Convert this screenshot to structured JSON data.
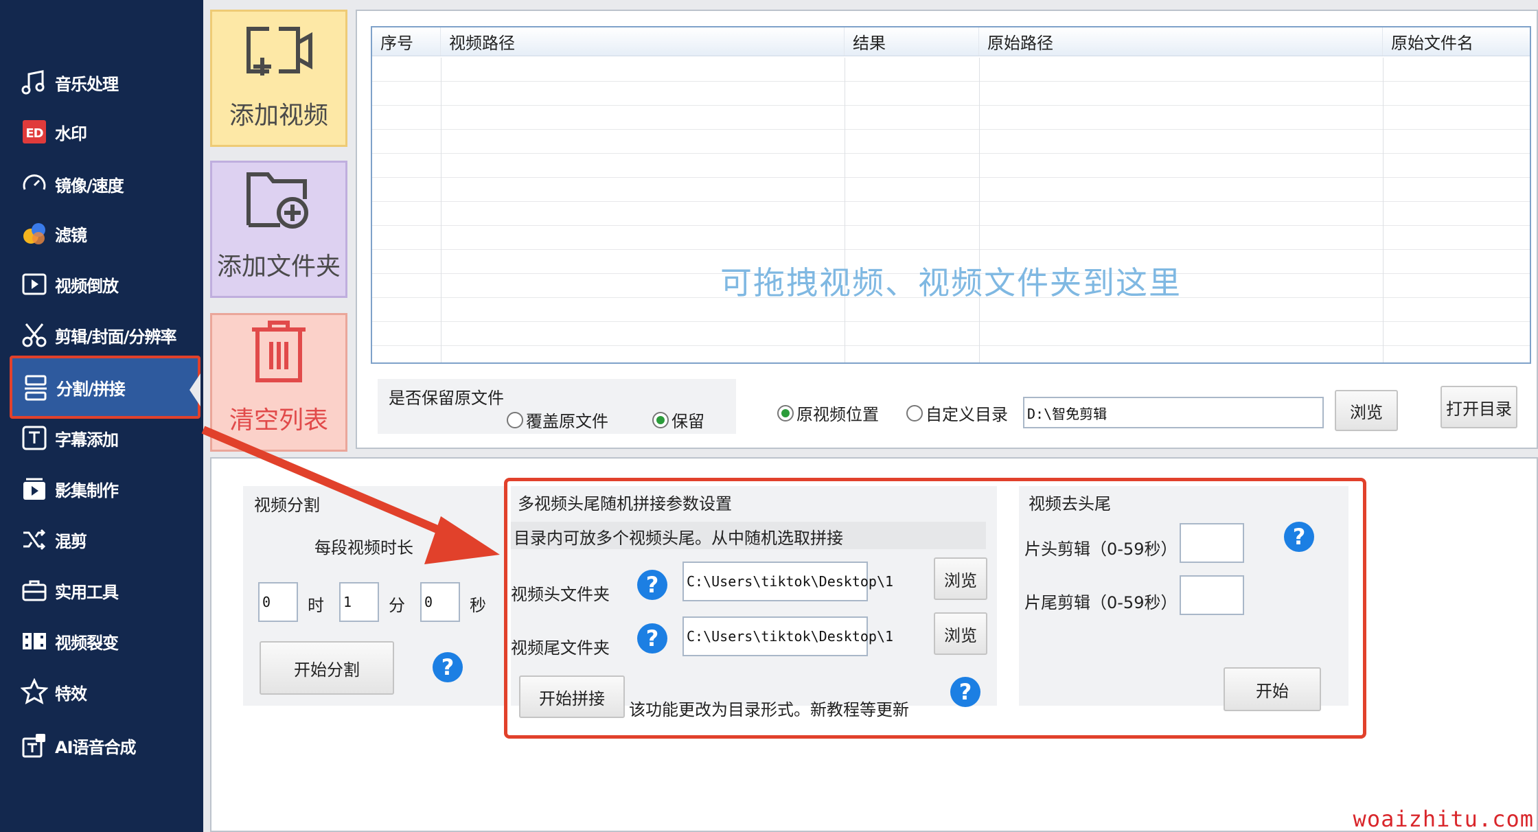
{
  "sidebar": {
    "items": [
      {
        "label": "音乐处理",
        "icon": "music-note-icon"
      },
      {
        "label": "水印",
        "icon": "watermark-icon"
      },
      {
        "label": "镜像/速度",
        "icon": "speedometer-icon"
      },
      {
        "label": "滤镜",
        "icon": "filter-circles-icon"
      },
      {
        "label": "视频倒放",
        "icon": "video-reverse-icon"
      },
      {
        "label": "剪辑/封面/分辨率",
        "icon": "scissors-icon"
      },
      {
        "label": "分割/拼接",
        "icon": "split-join-icon",
        "active": true
      },
      {
        "label": "字幕添加",
        "icon": "subtitle-icon"
      },
      {
        "label": "影集制作",
        "icon": "album-icon"
      },
      {
        "label": "混剪",
        "icon": "shuffle-icon"
      },
      {
        "label": "实用工具",
        "icon": "toolbox-icon"
      },
      {
        "label": "视频裂变",
        "icon": "film-split-icon"
      },
      {
        "label": "特效",
        "icon": "sparkle-star-icon"
      },
      {
        "label": "AI语音合成",
        "icon": "ai-voice-icon"
      }
    ]
  },
  "actions": {
    "add_video": "添加视频",
    "add_folder": "添加文件夹",
    "clear_list": "清空列表"
  },
  "table": {
    "columns": [
      "序号",
      "视频路径",
      "结果",
      "原始路径",
      "原始文件名"
    ],
    "drop_hint": "可拖拽视频、视频文件夹到这里"
  },
  "keep_original": {
    "title": "是否保留原文件",
    "overwrite": "覆盖原文件",
    "keep": "保留",
    "selected": "保留"
  },
  "output": {
    "original_location": "原视频位置",
    "custom_dir": "自定义目录",
    "selected": "原视频位置",
    "path": "D:\\智免剪辑",
    "browse": "浏览",
    "open_dir": "打开目录"
  },
  "split": {
    "title": "视频分割",
    "segment_label": "每段视频时长",
    "hours": "0",
    "hour_unit": "时",
    "minutes": "1",
    "minute_unit": "分",
    "seconds": "0",
    "second_unit": "秒",
    "start": "开始分割"
  },
  "concat": {
    "title": "多视频头尾随机拼接参数设置",
    "desc": "目录内可放多个视频头尾。从中随机选取拼接",
    "head_label": "视频头文件夹",
    "head_path": "C:\\Users\\tiktok\\Desktop\\1",
    "tail_label": "视频尾文件夹",
    "tail_path": "C:\\Users\\tiktok\\Desktop\\1",
    "browse": "浏览",
    "start": "开始拼接",
    "note": "该功能更改为目录形式。新教程等更新"
  },
  "trim": {
    "title": "视频去头尾",
    "head_label": "片头剪辑（0-59秒）",
    "tail_label": "片尾剪辑（0-59秒）",
    "start": "开始"
  },
  "help": "?",
  "watermark": "woaizhitu.com",
  "colors": {
    "sidebar_bg": "#13284e",
    "active_item": "#2e5a9e",
    "annotation_red": "#e1412b",
    "help_blue": "#1c7fe3",
    "hint_blue": "#7fb8e2"
  }
}
